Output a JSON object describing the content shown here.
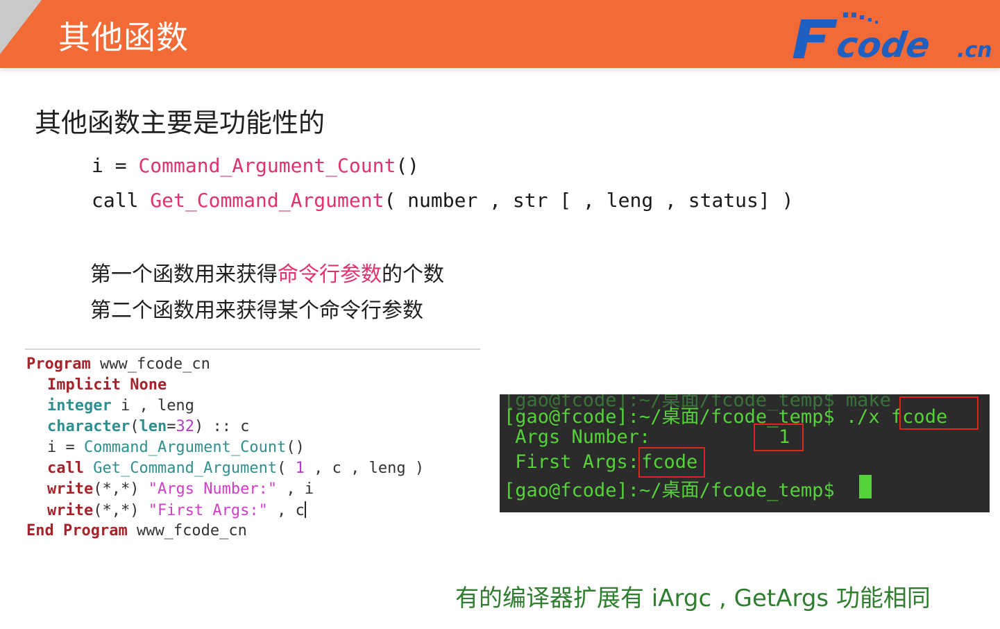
{
  "header": {
    "title": "其他函数",
    "logo_text": "Fcode.cn",
    "background_color": "#f26a35"
  },
  "main": {
    "heading": "其他函数主要是功能性的",
    "syntax": {
      "line1": {
        "prefix": "i = ",
        "fn": "Command_Argument_Count",
        "suffix": "()"
      },
      "line2": {
        "prefix": "call ",
        "fn": "Get_Command_Argument",
        "suffix": "( number , str [ , leng , status] )"
      }
    },
    "desc1": {
      "before": "第一个函数用来获得",
      "highlight": "命令行参数",
      "after": "的个数"
    },
    "desc2": "第二个函数用来获得某个命令行参数"
  },
  "editor": {
    "l1": {
      "kw": "Program",
      "rest": " www_fcode_cn"
    },
    "l2": {
      "kw1": "Implicit",
      "kw2": " None"
    },
    "l3": {
      "ty": "integer",
      "rest": " i , leng"
    },
    "l4": {
      "ty": "character",
      "p1": "(",
      "ty2": "len",
      "p2": "=",
      "num": "32",
      "rest": ") :: c"
    },
    "l5": {
      "rest1": "i = ",
      "fn": "Command_Argument_Count",
      "rest2": "()"
    },
    "l6": {
      "kw": "call",
      "sp": " ",
      "fn": "Get_Command_Argument",
      "p1": "( ",
      "num": "1",
      "rest": " , c , leng )"
    },
    "l7": {
      "kw": "write",
      "p1": "(*,*) ",
      "str": "\"Args Number:\"",
      "rest": " , i"
    },
    "l8": {
      "kw": "write",
      "p1": "(*,*) ",
      "str": "\"First Args:\"",
      "rest": " , c"
    },
    "l9": {
      "kw": "End Program",
      "rest": " www_fcode_cn"
    }
  },
  "terminal": {
    "ghost": "[gao@fcode]:~/桌面/fcode_temp$ make",
    "line1_prompt": "[gao@fcode]:~/桌面/fcode_temp$ ./x ",
    "line1_arg": "fcode",
    "line2_label": " Args Number:",
    "line2_value": "1",
    "line3_label": " First Args:",
    "line3_value": "fcode",
    "line4_prompt": "[gao@fcode]:~/桌面/fcode_temp$ "
  },
  "footer": {
    "note": "有的编译器扩展有 iArgc , GetArgs 功能相同"
  },
  "colors": {
    "accent": "#f26a35",
    "function_highlight": "#e0326e",
    "terminal_green": "#55d13a",
    "note_green": "#2f7d2f",
    "box_red": "#e2241c"
  }
}
